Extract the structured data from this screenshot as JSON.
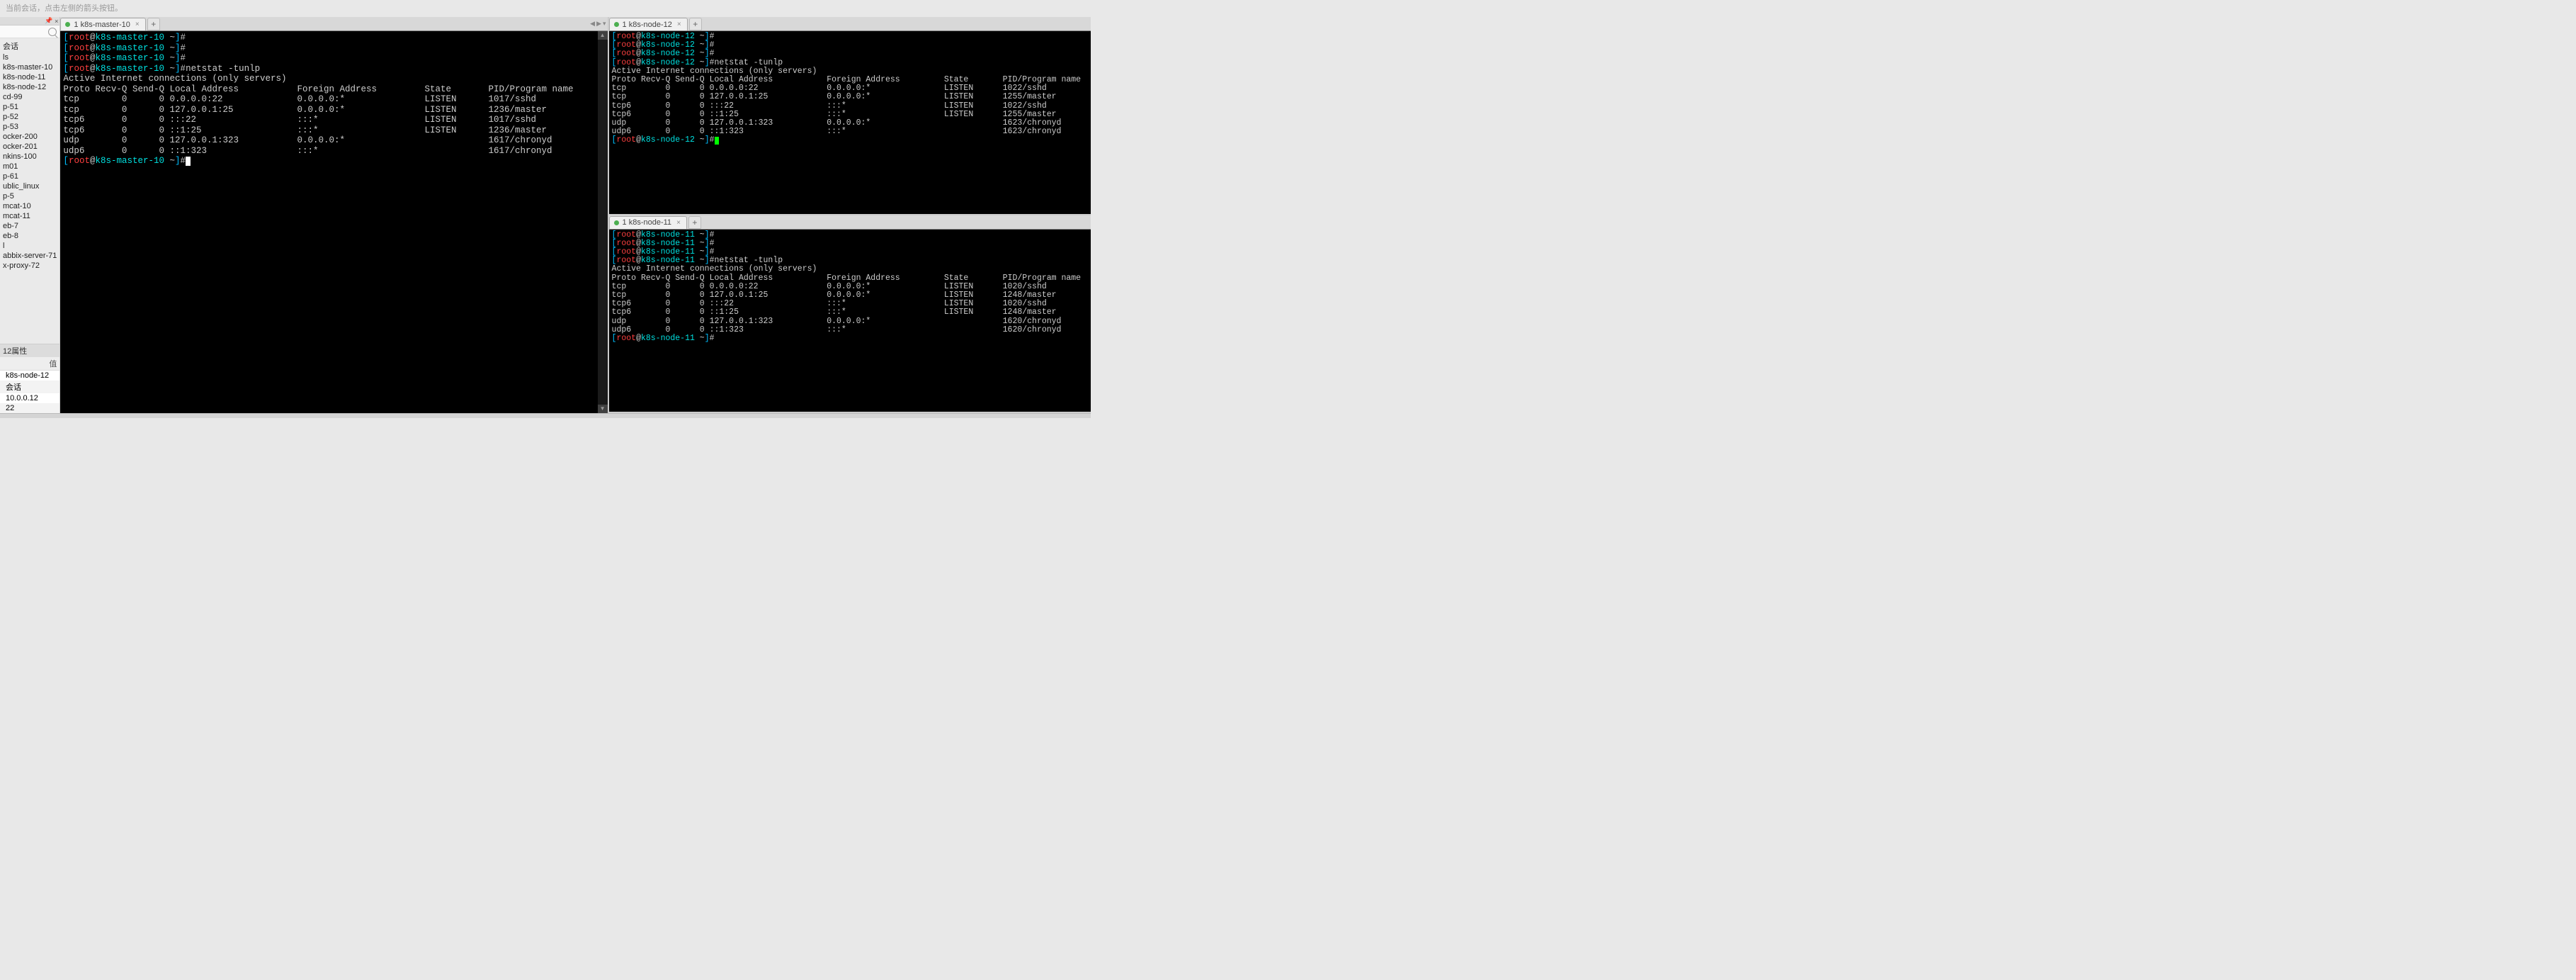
{
  "topbar_hint": "当前会话，点击左侧的箭头按钮。",
  "sidebar": {
    "icons": {
      "pin": "📌",
      "close": "×"
    },
    "header": "会话",
    "items": [
      "ls",
      "k8s-master-10",
      "k8s-node-11",
      "k8s-node-12",
      "cd-99",
      "p-51",
      "p-52",
      "p-53",
      "ocker-200",
      "ocker-201",
      "nkins-100",
      "m01",
      "p-61",
      "ublic_linux",
      "p-5",
      "mcat-10",
      "mcat-11",
      "eb-7",
      "eb-8",
      "l",
      "abbix-server-71",
      "x-proxy-72"
    ],
    "selected_index": -1
  },
  "props": {
    "title": "12属性",
    "col_header": "值",
    "rows": [
      "k8s-node-12",
      "会话",
      "10.0.0.12",
      "22"
    ]
  },
  "panes": {
    "left": {
      "tab_label": "1 k8s-master-10",
      "prompt": {
        "user": "root",
        "host": "k8s-master-10",
        "path": "~"
      },
      "blank_prompts": 3,
      "command": "netstat -tunlp",
      "header_line": "Active Internet connections (only servers)",
      "col_line": "Proto Recv-Q Send-Q Local Address           Foreign Address         State       PID/Program name    ",
      "rows": [
        "tcp        0      0 0.0.0.0:22              0.0.0.0:*               LISTEN      1017/sshd           ",
        "tcp        0      0 127.0.0.1:25            0.0.0.0:*               LISTEN      1236/master         ",
        "tcp6       0      0 :::22                   :::*                    LISTEN      1017/sshd           ",
        "tcp6       0      0 ::1:25                  :::*                    LISTEN      1236/master         ",
        "udp        0      0 127.0.0.1:323           0.0.0.0:*                           1617/chronyd        ",
        "udp6       0      0 ::1:323                 :::*                                1617/chronyd        "
      ],
      "cursor": "white"
    },
    "top_right": {
      "tab_label": "1 k8s-node-12",
      "prompt": {
        "user": "root",
        "host": "k8s-node-12",
        "path": "~"
      },
      "blank_prompts": 3,
      "command": "netstat -tunlp",
      "header_line": "Active Internet connections (only servers)",
      "col_line": "Proto Recv-Q Send-Q Local Address           Foreign Address         State       PID/Program name    ",
      "rows": [
        "tcp        0      0 0.0.0.0:22              0.0.0.0:*               LISTEN      1022/sshd           ",
        "tcp        0      0 127.0.0.1:25            0.0.0.0:*               LISTEN      1255/master         ",
        "tcp6       0      0 :::22                   :::*                    LISTEN      1022/sshd           ",
        "tcp6       0      0 ::1:25                  :::*                    LISTEN      1255/master         ",
        "udp        0      0 127.0.0.1:323           0.0.0.0:*                           1623/chronyd        ",
        "udp6       0      0 ::1:323                 :::*                                1623/chronyd        "
      ],
      "cursor": "green"
    },
    "bottom_right": {
      "tab_label": "1 k8s-node-11",
      "prompt": {
        "user": "root",
        "host": "k8s-node-11",
        "path": "~"
      },
      "blank_prompts": 3,
      "command": "netstat -tunlp",
      "header_line": "Active Internet connections (only servers)",
      "col_line": "Proto Recv-Q Send-Q Local Address           Foreign Address         State       PID/Program name    ",
      "rows": [
        "tcp        0      0 0.0.0.0:22              0.0.0.0:*               LISTEN      1020/sshd           ",
        "tcp        0      0 127.0.0.1:25            0.0.0.0:*               LISTEN      1248/master         ",
        "tcp6       0      0 :::22                   :::*                    LISTEN      1020/sshd           ",
        "tcp6       0      0 ::1:25                  :::*                    LISTEN      1248/master         ",
        "udp        0      0 127.0.0.1:323           0.0.0.0:*                           1620/chronyd        ",
        "udp6       0      0 ::1:323                 :::*                                1620/chronyd        "
      ],
      "cursor": "green-empty"
    }
  }
}
